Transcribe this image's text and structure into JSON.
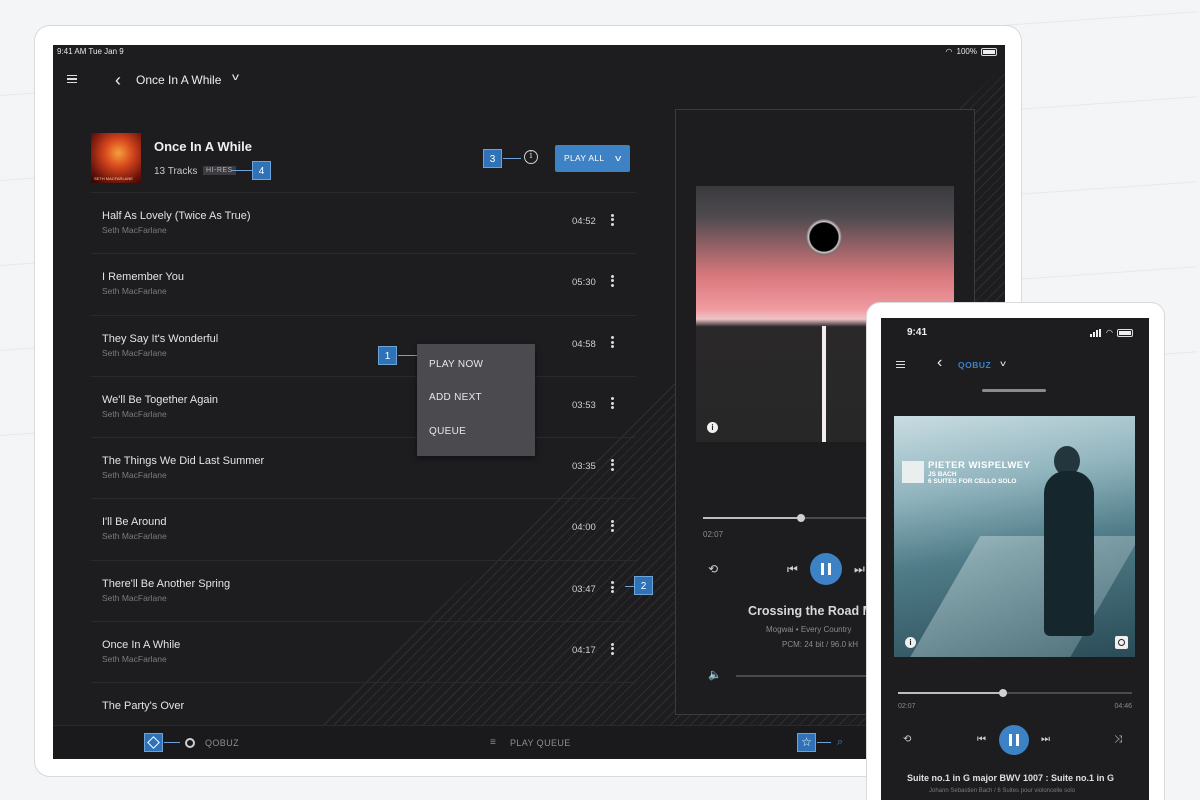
{
  "tablet": {
    "status": {
      "time": "9:41 AM  Tue Jan 9",
      "battery": "100%"
    },
    "nav": {
      "title": "Once In A While"
    },
    "album": {
      "title": "Once In A While",
      "tracks_count": "13 Tracks",
      "badge": "HI-RES",
      "art_caption": "SETH MACFARLANE",
      "play_all_label": "PLAY ALL"
    },
    "tracks": [
      {
        "title": "Half As Lovely (Twice As True)",
        "artist": "Seth MacFarlane",
        "duration": "04:52"
      },
      {
        "title": "I Remember You",
        "artist": "Seth MacFarlane",
        "duration": "05:30"
      },
      {
        "title": "They Say It's Wonderful",
        "artist": "Seth MacFarlane",
        "duration": "04:58"
      },
      {
        "title": "We'll Be Together Again",
        "artist": "Seth MacFarlane",
        "duration": "03:53"
      },
      {
        "title": "The Things We Did Last Summer",
        "artist": "Seth MacFarlane",
        "duration": "03:35"
      },
      {
        "title": "I'll Be Around",
        "artist": "Seth MacFarlane",
        "duration": "04:00"
      },
      {
        "title": "There'll Be Another Spring",
        "artist": "Seth MacFarlane",
        "duration": "03:47"
      },
      {
        "title": "Once In A While",
        "artist": "Seth MacFarlane",
        "duration": "04:17"
      },
      {
        "title": "The Party's Over",
        "artist": "",
        "duration": ""
      }
    ],
    "context_menu": [
      "PLAY NOW",
      "ADD NEXT",
      "QUEUE"
    ],
    "callouts": [
      "1",
      "2",
      "3",
      "4"
    ],
    "now_playing": {
      "elapsed": "02:07",
      "progress_fraction": 0.4,
      "title": "Crossing the Road M",
      "subtitle": "Mogwai • Every Country",
      "format": "PCM: 24 bit / 96.0 kH"
    },
    "bottom_bar": {
      "source_label": "QOBUZ",
      "queue_label": "PLAY QUEUE"
    }
  },
  "phone": {
    "status": {
      "time": "9:41"
    },
    "nav": {
      "title": "QOBUZ"
    },
    "art": {
      "artist": "PIETER WISPELWEY",
      "line1": "JS BACH",
      "line2": "6 SUITES FOR CELLO SOLO"
    },
    "elapsed": "02:07",
    "total": "04:46",
    "progress_fraction": 0.45,
    "track_title": "Suite no.1 in G major BWV 1007 : Suite no.1 in G",
    "track_subtitle": "Johann Sebastien Bach / 6 Suites pour violoncelle solo"
  },
  "colors": {
    "accent": "#3d82c4",
    "callout": "#2f72b8",
    "background": "#1d1d20"
  }
}
